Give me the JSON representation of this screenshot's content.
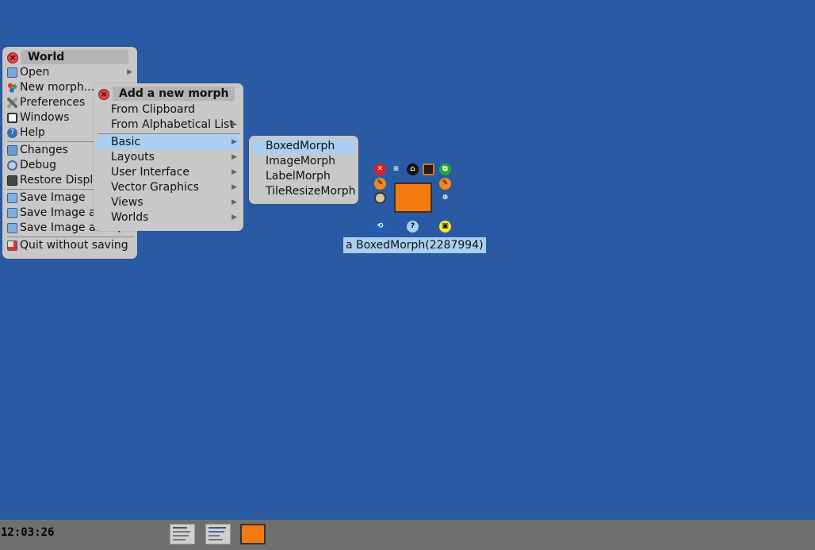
{
  "world_menu": {
    "title": "World",
    "items": [
      {
        "label": "Open",
        "icon": "folder-icon",
        "submenu": true
      },
      {
        "label": "New morph...",
        "icon": "new-morph-icon",
        "submenu": false
      },
      {
        "label": "Preferences",
        "icon": "wrench-screwdriver-icon",
        "submenu": false
      },
      {
        "label": "Windows",
        "icon": "windows-icon",
        "submenu": false
      },
      {
        "label": "Help",
        "icon": "help-icon",
        "submenu": false
      },
      {
        "label": "Changes",
        "icon": "changes-icon",
        "submenu": false
      },
      {
        "label": "Debug",
        "icon": "debug-icon",
        "submenu": false
      },
      {
        "label": "Restore Display",
        "icon": "display-icon",
        "submenu": false
      },
      {
        "label": "Save Image",
        "icon": "save-icon",
        "submenu": false
      },
      {
        "label": "Save Image as...",
        "icon": "save-as-icon",
        "submenu": false
      },
      {
        "label": "Save Image and Quit",
        "icon": "save-quit-icon",
        "submenu": false
      },
      {
        "label": "Quit without saving",
        "icon": "quit-icon",
        "submenu": false
      }
    ]
  },
  "add_morph_menu": {
    "title": "Add a new morph",
    "items": [
      {
        "label": "From Clipboard",
        "submenu": false
      },
      {
        "label": "From Alphabetical List",
        "submenu": true
      },
      {
        "label": "Basic",
        "submenu": true,
        "highlighted": true
      },
      {
        "label": "Layouts",
        "submenu": true
      },
      {
        "label": "User Interface",
        "submenu": true
      },
      {
        "label": "Vector Graphics",
        "submenu": true
      },
      {
        "label": "Views",
        "submenu": true
      },
      {
        "label": "Worlds",
        "submenu": true
      }
    ]
  },
  "basic_menu": {
    "items": [
      {
        "label": "BoxedMorph",
        "highlighted": true
      },
      {
        "label": "ImageMorph"
      },
      {
        "label": "LabelMorph"
      },
      {
        "label": "TileResizeMorph"
      }
    ]
  },
  "halo": {
    "label": "a BoxedMorph(2287994)",
    "morph_color": "#f47a10",
    "handles": [
      "close-handle-icon",
      "menu-handle-icon",
      "pick-up-handle-icon",
      "move-handle-icon",
      "duplicate-handle-icon",
      "debug-handle-icon",
      "grab-handle-icon",
      "collapse-handle-icon",
      "resize-handle-icon",
      "rotate-handle-icon",
      "help-handle-icon",
      "scale-handle-icon",
      "zoom-handle-icon",
      "color-handle-icon"
    ]
  },
  "taskbar": {
    "clock": "12:03:26"
  },
  "colors": {
    "desktop": "#2b5aa4",
    "menu": "#c8c8c8",
    "highlight": "#a9d0f2",
    "taskbar": "#6f6f6f"
  }
}
